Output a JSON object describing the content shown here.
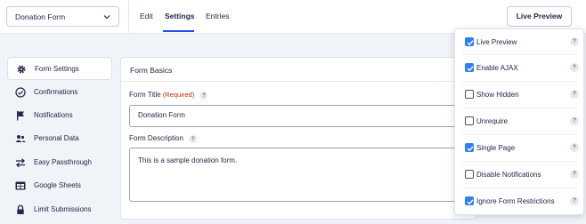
{
  "form_selector": {
    "value": "Donation Form"
  },
  "nav": {
    "tabs": [
      {
        "label": "Edit"
      },
      {
        "label": "Settings"
      },
      {
        "label": "Entries"
      }
    ]
  },
  "live_preview_button": {
    "label": "Live Preview"
  },
  "sidebar": {
    "items": [
      {
        "label": "Form Settings",
        "icon": "gear-icon"
      },
      {
        "label": "Confirmations",
        "icon": "check-circle-icon"
      },
      {
        "label": "Notifications",
        "icon": "flag-icon"
      },
      {
        "label": "Personal Data",
        "icon": "users-icon"
      },
      {
        "label": "Easy Passthrough",
        "icon": "arrows-swap-icon"
      },
      {
        "label": "Google Sheets",
        "icon": "table-icon"
      },
      {
        "label": "Limit Submissions",
        "icon": "lock-icon"
      }
    ]
  },
  "form_basics": {
    "heading": "Form Basics",
    "title_label": "Form Title",
    "required_text": "(Required)",
    "title_value": "Donation Form",
    "description_label": "Form Description",
    "description_value": "This is a sample donation form.",
    "help_glyph": "?"
  },
  "preview_options": {
    "items": [
      {
        "label": "Live Preview",
        "checked": true
      },
      {
        "label": "Enable AJAX",
        "checked": true
      },
      {
        "label": "Show Hidden",
        "checked": false
      },
      {
        "label": "Unrequire",
        "checked": false
      },
      {
        "label": "Single Page",
        "checked": true
      },
      {
        "label": "Disable Notifications",
        "checked": false
      },
      {
        "label": "Ignore Form Restrictions",
        "checked": true
      }
    ]
  },
  "colors": {
    "accent": "#204ce5",
    "checkbox": "#2f80ed",
    "required": "#c02b0a",
    "text": "#242748"
  }
}
